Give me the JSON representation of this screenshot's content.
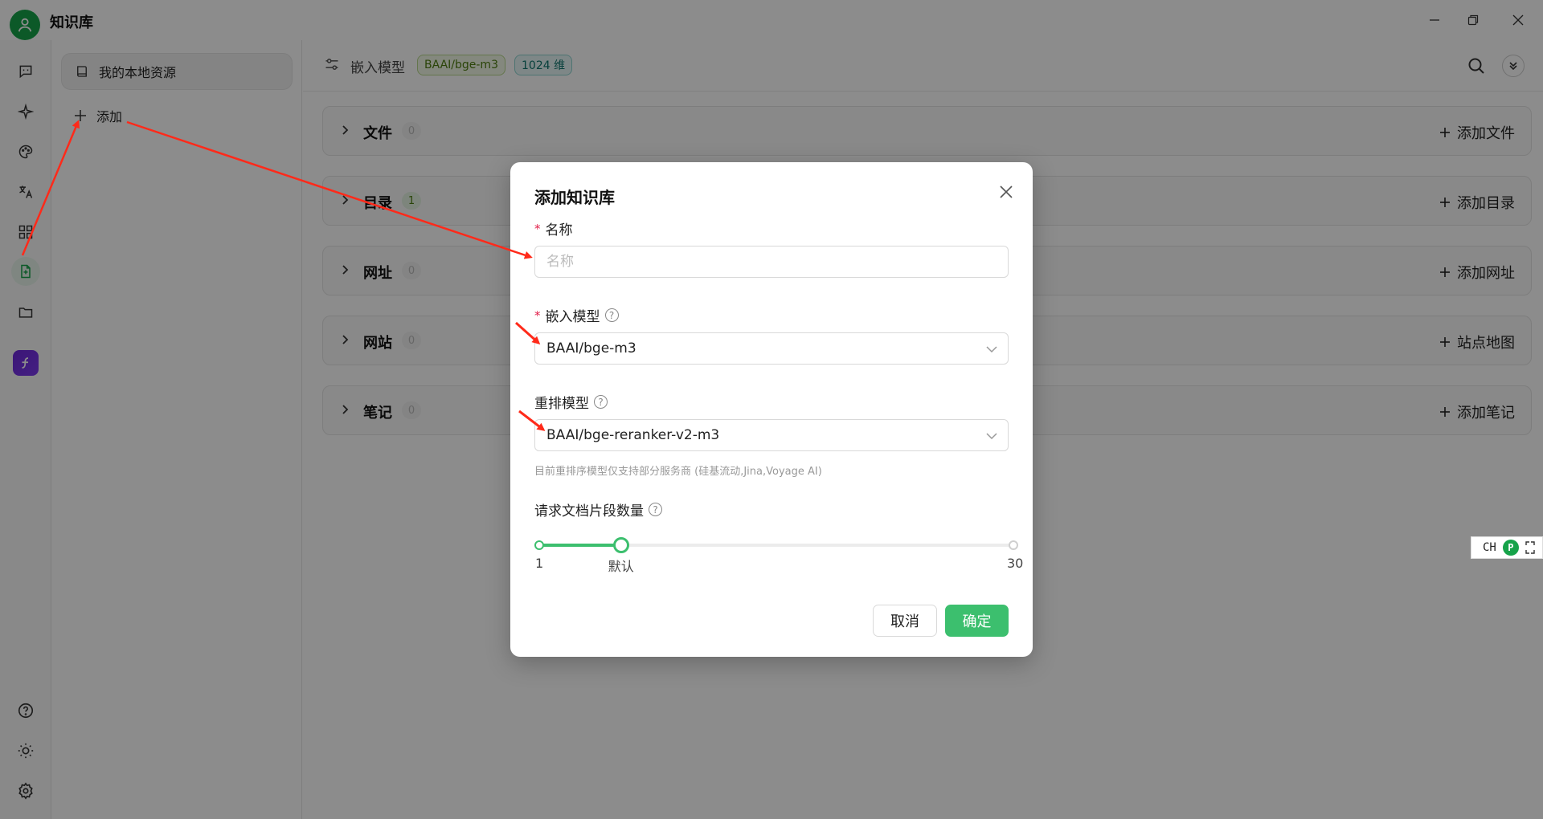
{
  "app": {
    "title": "知识库"
  },
  "sidebar": {
    "knowledge_base": "我的本地资源",
    "add_label": "添加"
  },
  "topbar": {
    "label": "嵌入模型",
    "model_tag": "BAAI/bge-m3",
    "dim_tag": "1024 维"
  },
  "sections": [
    {
      "title": "文件",
      "count": "0",
      "action": "添加文件"
    },
    {
      "title": "目录",
      "count": "1",
      "action": "添加目录"
    },
    {
      "title": "网址",
      "count": "0",
      "action": "添加网址"
    },
    {
      "title": "网站",
      "count": "0",
      "action": "站点地图"
    },
    {
      "title": "笔记",
      "count": "0",
      "action": "添加笔记"
    }
  ],
  "modal": {
    "title": "添加知识库",
    "name_label": "名称",
    "name_placeholder": "名称",
    "embed_label": "嵌入模型",
    "embed_value": "BAAI/bge-m3",
    "rerank_label": "重排模型",
    "rerank_value": "BAAI/bge-reranker-v2-m3",
    "rerank_hint": "目前重排序模型仅支持部分服务商 (硅基流动,Jina,Voyage AI)",
    "chunks_label": "请求文档片段数量",
    "slider": {
      "min": "1",
      "default_label": "默认",
      "max": "30",
      "value": 6,
      "min_value": 1,
      "max_value": 30
    },
    "cancel": "取消",
    "confirm": "确定"
  },
  "ime": {
    "label": "CH"
  },
  "colors": {
    "accent": "#3cbf6e",
    "annotation": "#ff2a1a"
  }
}
